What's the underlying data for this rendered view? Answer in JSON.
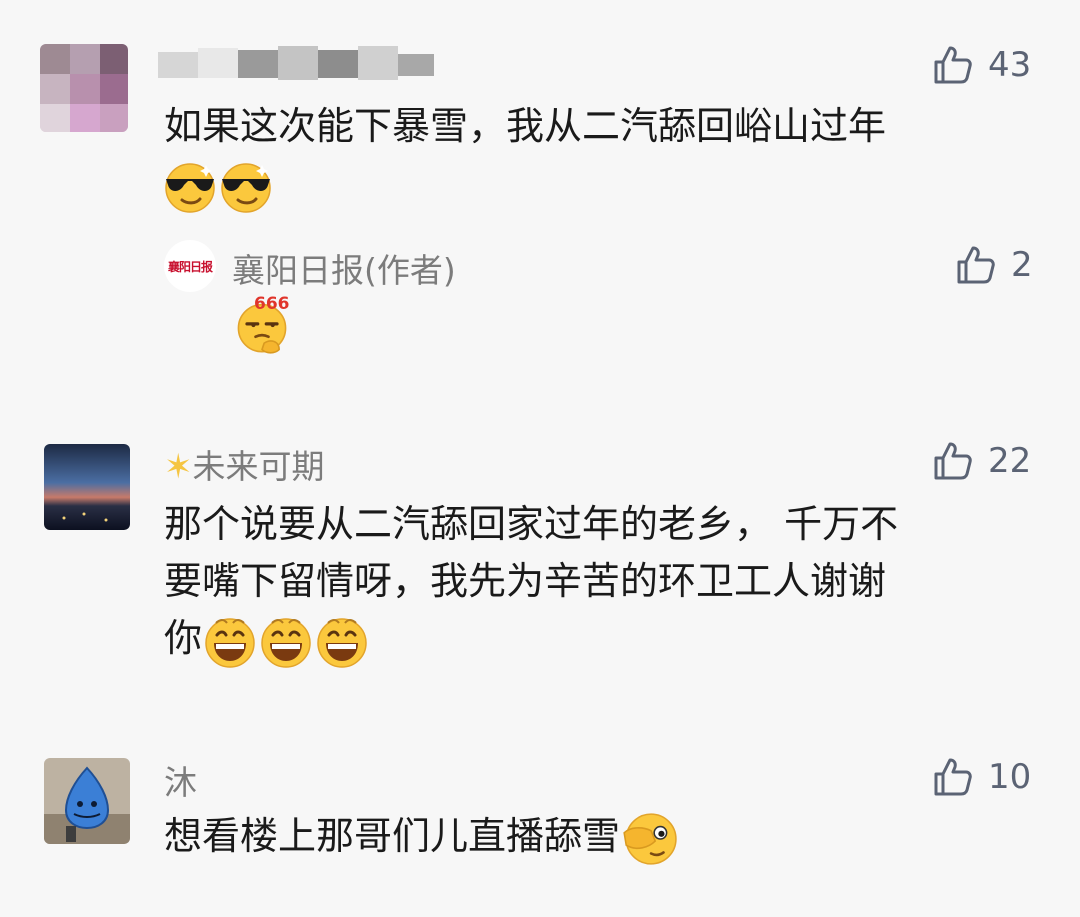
{
  "comments": [
    {
      "name": "",
      "text": "如果这次能下暴雪，我从二汽舔回峪山过年",
      "likes": "43"
    },
    {
      "name": "襄阳日报(作者)",
      "avatar_text": "襄阳日报",
      "emoji_label": "666",
      "likes": "2"
    },
    {
      "name": "未来可期",
      "text_line1": "那个说要从二汽舔回家过年的老乡， 千万不",
      "text_line2": "要嘴下留情呀，我先为辛苦的环卫工人谢谢",
      "text_line3": "你",
      "likes": "22"
    },
    {
      "name": "沐",
      "text": "想看楼上那哥们儿直播舔雪",
      "likes": "10"
    }
  ],
  "colors": {
    "background": "#f7f7f7",
    "name": "#7c7c7c",
    "like_icon": "#5b6374",
    "brand_red": "#c8102e"
  },
  "icons": [
    "thumbs-up-icon",
    "sunglasses-emoji",
    "grin-emoji",
    "666-emoji",
    "star-icon",
    "facepalm-emoji"
  ]
}
